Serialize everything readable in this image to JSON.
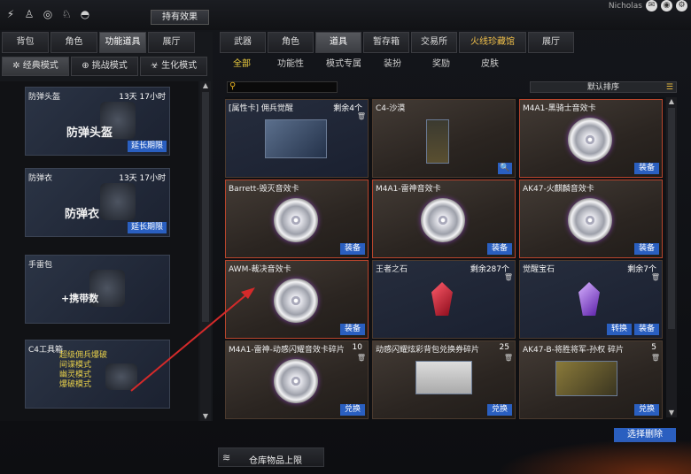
{
  "topbar": {
    "effect_label": "持有效果",
    "user": "Nicholas"
  },
  "left_tabs": [
    {
      "label": "背包",
      "active": false
    },
    {
      "label": "角色",
      "active": false
    },
    {
      "label": "功能道具",
      "active": true
    },
    {
      "label": "展厅",
      "active": false
    }
  ],
  "left_modes": [
    {
      "label": "经典模式",
      "active": true
    },
    {
      "label": "挑战模式",
      "active": false
    },
    {
      "label": "生化模式",
      "active": false
    }
  ],
  "left_items": [
    {
      "name": "防弹头盔",
      "time": "13天 17小时",
      "big": "防弹头盔",
      "button": "延长期限"
    },
    {
      "name": "防弹衣",
      "time": "13天 17小时",
      "big": "防弹衣",
      "button": "延长期限"
    },
    {
      "name": "手雷包",
      "big": "+携带数"
    },
    {
      "name": "C4工具箱",
      "modes": [
        "超级佣兵爆破",
        "间谍模式",
        "幽灵模式",
        "爆破模式"
      ]
    }
  ],
  "right_tabs": [
    {
      "label": "武器",
      "active": false
    },
    {
      "label": "角色",
      "active": false
    },
    {
      "label": "道具",
      "active": true
    },
    {
      "label": "暂存箱",
      "active": false
    },
    {
      "label": "交易所",
      "active": false
    },
    {
      "label": "火线珍藏馆",
      "active": false,
      "gold": true
    },
    {
      "label": "展厅",
      "active": false
    }
  ],
  "sub_tabs": [
    {
      "label": "全部",
      "active": true
    },
    {
      "label": "功能性",
      "active": false
    },
    {
      "label": "模式专属",
      "active": false
    },
    {
      "label": "装扮",
      "active": false
    },
    {
      "label": "奖励",
      "active": false
    },
    {
      "label": "皮肤",
      "active": false
    }
  ],
  "sort_label": "默认排序",
  "cards": [
    {
      "title": "[属性卡] 佣兵觉醒",
      "count": "剩余4个",
      "type": "card",
      "blue": true,
      "buttons": []
    },
    {
      "title": "C4-沙漠",
      "count": "",
      "type": "c4",
      "buttons": [
        "magnify"
      ]
    },
    {
      "title": "M4A1-黑骑士音效卡",
      "count": "",
      "type": "disc",
      "buttons": [
        "装备"
      ]
    },
    {
      "title": "Barrett-毁灭音效卡",
      "count": "",
      "type": "disc",
      "buttons": [
        "装备"
      ]
    },
    {
      "title": "M4A1-雷神音效卡",
      "count": "",
      "type": "disc",
      "buttons": [
        "装备"
      ]
    },
    {
      "title": "AK47-火麒麟音效卡",
      "count": "",
      "type": "disc",
      "buttons": [
        "装备"
      ]
    },
    {
      "title": "AWM-裁决音效卡",
      "count": "",
      "type": "disc",
      "selected": true,
      "buttons": [
        "装备"
      ]
    },
    {
      "title": "王者之石",
      "count": "剩余287个",
      "type": "gem",
      "blue": true,
      "buttons": []
    },
    {
      "title": "觉醒宝石",
      "count": "剩余7个",
      "type": "gem-purple",
      "blue": true,
      "buttons": [
        "转换",
        "装备"
      ]
    },
    {
      "title": "M4A1-雷神-动感闪耀音效卡碎片",
      "count": "10",
      "type": "disc",
      "buttons": [
        "兑换"
      ]
    },
    {
      "title": "动感闪耀炫彩背包兑换券碎片",
      "count": "25",
      "type": "ticket",
      "buttons": [
        "兑换"
      ]
    },
    {
      "title": "AK47-B-将胜将军-孙权 碎片",
      "count": "5",
      "type": "gun",
      "buttons": [
        "兑换"
      ]
    }
  ],
  "delete_label": "选择删除",
  "footer_label": "仓库物品上限",
  "colors": {
    "accent_blue": "#2a5fc0",
    "active_gold": "#f0d040",
    "arrow_red": "#d42a2a"
  }
}
